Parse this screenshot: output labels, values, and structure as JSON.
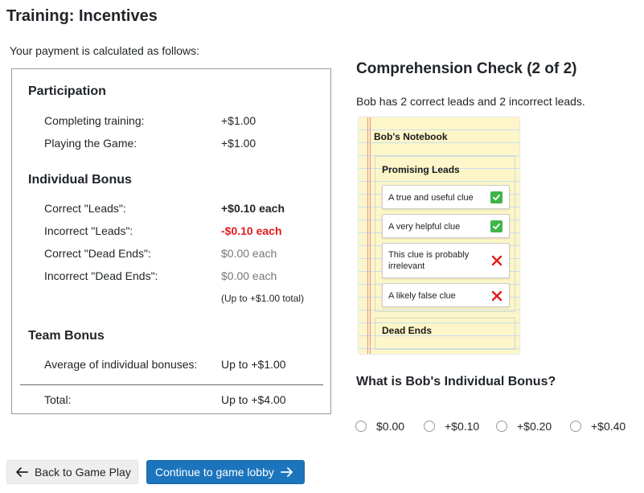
{
  "page": {
    "title": "Training: Incentives",
    "intro": "Your payment is calculated as follows:"
  },
  "payment": {
    "participation": {
      "heading": "Participation",
      "rows": [
        {
          "label": "Completing training:",
          "value": "+$1.00"
        },
        {
          "label": "Playing the Game:",
          "value": "+$1.00"
        }
      ]
    },
    "individual": {
      "heading": "Individual Bonus",
      "rows": [
        {
          "label": "Correct \"Leads\":",
          "value": "+$0.10 each"
        },
        {
          "label": "Incorrect \"Leads\":",
          "value": "-$0.10 each"
        },
        {
          "label": "Correct \"Dead Ends\":",
          "value": "$0.00 each"
        },
        {
          "label": "Incorrect \"Dead Ends\":",
          "value": "$0.00 each"
        }
      ],
      "note": "(Up to +$1.00 total)"
    },
    "team": {
      "heading": "Team Bonus",
      "rows": [
        {
          "label": "Average of individual bonuses:",
          "value": "Up to +$1.00"
        }
      ]
    },
    "total": {
      "label": "Total:",
      "value": "Up to +$4.00"
    }
  },
  "check": {
    "title": "Comprehension Check (2 of 2)",
    "description": "Bob has 2 correct leads and 2 incorrect leads.",
    "notebook": {
      "title": "Bob's Notebook",
      "promising_title": "Promising Leads",
      "clues": [
        {
          "text": "A true and useful clue",
          "mark": "check-icon"
        },
        {
          "text": "A very helpful clue",
          "mark": "check-icon"
        },
        {
          "text": "This clue is probably irrelevant",
          "mark": "cross-icon"
        },
        {
          "text": "A likely false clue",
          "mark": "cross-icon"
        }
      ],
      "dead_ends_title": "Dead Ends"
    },
    "question": "What is Bob's Individual Bonus?",
    "options": [
      "$0.00",
      "+$0.10",
      "+$0.20",
      "+$0.40"
    ]
  },
  "buttons": {
    "back": "Back to Game Play",
    "continue": "Continue to game lobby"
  },
  "colors": {
    "negative": "#e41a1c",
    "primary": "#1c75bc",
    "check": "#3fb44a",
    "cross": "#e41a1c",
    "notebook_bg": "#fdf6c8"
  }
}
